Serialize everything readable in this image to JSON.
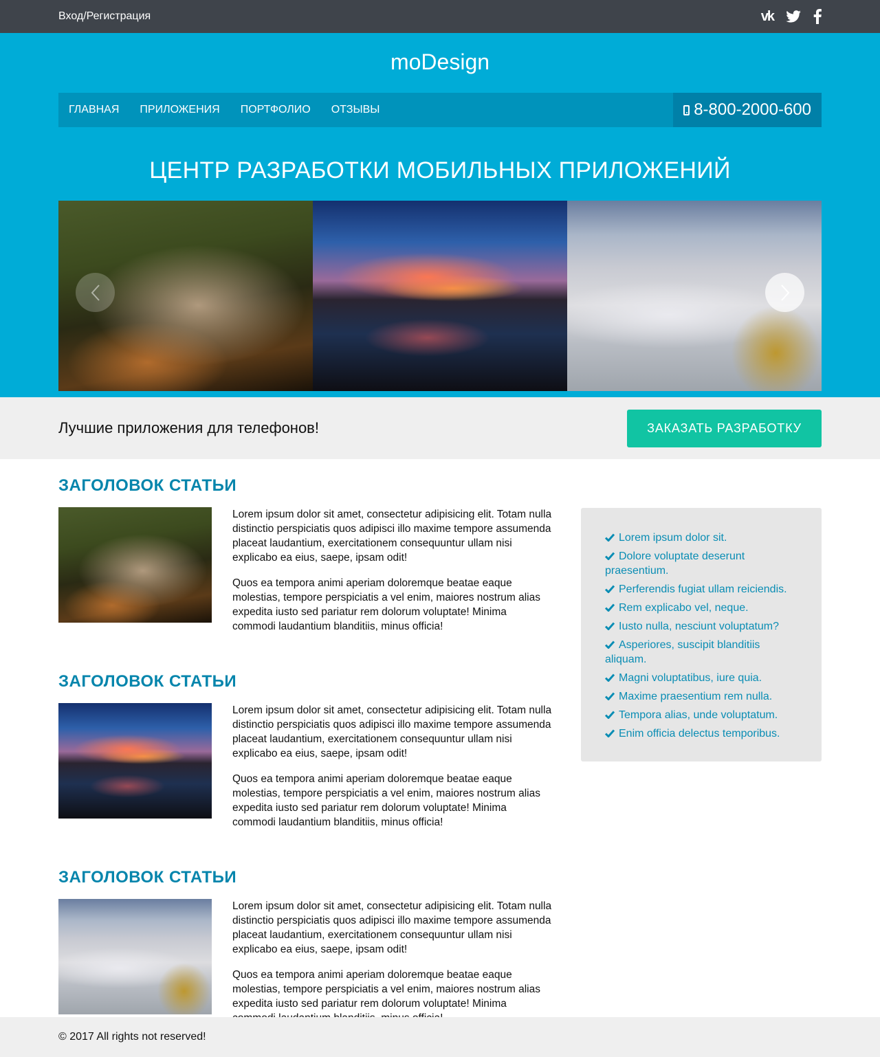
{
  "topbar": {
    "login": "Вход/Регистрация",
    "social": [
      "vk-icon",
      "twitter-icon",
      "facebook-icon"
    ],
    "vk_text": "vk"
  },
  "header": {
    "logo": "moDesign",
    "nav": [
      {
        "label": "ГЛАВНАЯ"
      },
      {
        "label": "ПРИЛОЖЕНИЯ"
      },
      {
        "label": "ПОРТФОЛИО"
      },
      {
        "label": "ОТЗЫВЫ"
      }
    ],
    "phone": "8-800-2000-600",
    "hero_title": "ЦЕНТР РАЗРАБОТКИ МОБИЛЬНЫХ ПРИЛОЖЕНИЙ"
  },
  "slider": {
    "slides": [
      "town-in-mountains-photo",
      "sunset-over-lake-photo",
      "clouds-over-forest-photo"
    ]
  },
  "cta": {
    "text": "Лучшие приложения для телефонов!",
    "button": "ЗАКАЗАТЬ РАЗРАБОТКУ"
  },
  "articles": [
    {
      "title": "ЗАГОЛОВОК СТАТЬИ",
      "p1": "Lorem ipsum dolor sit amet, consectetur adipisicing elit. Totam nulla distinctio perspiciatis quos adipisci illo maxime tempore assumenda placeat laudantium, exercitationem consequuntur ullam nisi explicabo ea eius, saepe, ipsam odit!",
      "p2": "Quos ea tempora animi aperiam doloremque beatae eaque molestias, tempore perspiciatis a vel enim, maiores nostrum alias expedita iusto sed pariatur rem dolorum voluptate! Minima commodi laudantium blanditiis, minus officia!"
    },
    {
      "title": "ЗАГОЛОВОК СТАТЬИ",
      "p1": "Lorem ipsum dolor sit amet, consectetur adipisicing elit. Totam nulla distinctio perspiciatis quos adipisci illo maxime tempore assumenda placeat laudantium, exercitationem consequuntur ullam nisi explicabo ea eius, saepe, ipsam odit!",
      "p2": "Quos ea tempora animi aperiam doloremque beatae eaque molestias, tempore perspiciatis a vel enim, maiores nostrum alias expedita iusto sed pariatur rem dolorum voluptate! Minima commodi laudantium blanditiis, minus officia!"
    },
    {
      "title": "ЗАГОЛОВОК СТАТЬИ",
      "p1": "Lorem ipsum dolor sit amet, consectetur adipisicing elit. Totam nulla distinctio perspiciatis quos adipisci illo maxime tempore assumenda placeat laudantium, exercitationem consequuntur ullam nisi explicabo ea eius, saepe, ipsam odit!",
      "p2": "Quos ea tempora animi aperiam doloremque beatae eaque molestias, tempore perspiciatis a vel enim, maiores nostrum alias expedita iusto sed pariatur rem dolorum voluptate! Minima commodi laudantium blanditiis, minus officia!"
    }
  ],
  "sidebar": {
    "items": [
      "Lorem ipsum dolor sit.",
      "Dolore voluptate deserunt praesentium.",
      "Perferendis fugiat ullam reiciendis.",
      "Rem explicabo vel, neque.",
      "Iusto nulla, nesciunt voluptatum?",
      "Asperiores, suscipit blanditiis aliquam.",
      "Magni voluptatibus, iure quia.",
      "Maxime praesentium rem nulla.",
      "Tempora alias, unde voluptatum.",
      "Enim officia delectus temporibus."
    ]
  },
  "footer": {
    "copyright": "© 2017 All rights not reserved!"
  },
  "colors": {
    "topbar": "#3f444b",
    "header_blue": "#00acd7",
    "nav_blue": "#0093bb",
    "heading_blue": "#0585ac",
    "cta_green": "#11c4a3",
    "panel_gray": "#e6e6e6"
  }
}
